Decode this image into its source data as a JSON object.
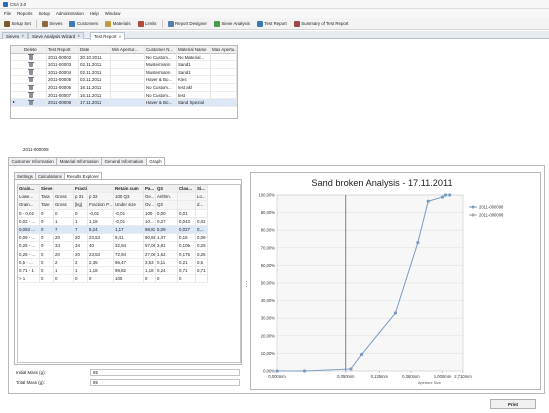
{
  "app": {
    "title": "CSA 3.0"
  },
  "menu": [
    "File",
    "Reports",
    "Setup",
    "Administration",
    "Help",
    "Window"
  ],
  "toolbar": [
    {
      "label": "Setup Set",
      "icon": "setup-icon",
      "color": "#7a5a2a"
    },
    {
      "label": "Sieves",
      "icon": "sieve-icon",
      "color": "#8b6b3a"
    },
    {
      "label": "Customers",
      "icon": "customers-icon",
      "color": "#3e78b9"
    },
    {
      "label": "Materials",
      "icon": "materials-icon",
      "color": "#c29a3f"
    },
    {
      "label": "Limits",
      "icon": "limits-icon",
      "color": "#b24a3b"
    },
    {
      "label": "Report Designer",
      "icon": "report-designer-icon",
      "color": "#5b7ea8"
    },
    {
      "label": "Sieve Analysis",
      "icon": "sieve-analysis-icon",
      "color": "#4a9a4a"
    },
    {
      "label": "Test Report",
      "icon": "test-report-icon",
      "color": "#3a7ab0"
    },
    {
      "label": "Summary of Test Report",
      "icon": "summary-icon",
      "color": "#a04848"
    }
  ],
  "doc_tabs": [
    {
      "label": "Sieves"
    },
    {
      "label": "Sieve Analysis Wizard"
    },
    {
      "label": "Test Report"
    }
  ],
  "reports": {
    "columns": [
      "Delete",
      "Test Report",
      "Date",
      "Min Apertur...",
      "Customer N...",
      "Material Name",
      "Max Apertu..."
    ],
    "rows": [
      [
        "",
        "2011-00002",
        "30.10.2011",
        "",
        "No Custom...",
        "No Material...",
        ""
      ],
      [
        "",
        "2011-00003",
        "02.11.2011",
        "",
        "Mustermann",
        "Sand1",
        ""
      ],
      [
        "",
        "2011-00004",
        "02.11.2011",
        "",
        "Mustermann",
        "Sand1",
        ""
      ],
      [
        "",
        "2011-00005",
        "03.11.2011",
        "",
        "Haver & Bo...",
        "Kies",
        ""
      ],
      [
        "",
        "2011-00006",
        "16.11.2011",
        "",
        "No Custom...",
        "test akl",
        ""
      ],
      [
        "",
        "2011-00007",
        "16.11.2011",
        "",
        "No Custom...",
        "test",
        ""
      ],
      [
        "",
        "2011-00008",
        "17.11.2011",
        "",
        "Haver & Bo...",
        "Sand Spezial",
        ""
      ]
    ],
    "selected_index": 6
  },
  "selected_report_id": "2011-000008",
  "section_tabs": [
    "Customer Information",
    "Material Information",
    "General Information",
    "Graph"
  ],
  "sub_tabs": [
    "Settings",
    "Calculations",
    "Results Explorer"
  ],
  "results": {
    "header": [
      "Grain...",
      "Sieve Weight",
      "",
      "Fraction Retain",
      "",
      "Retain cum",
      "Pa...",
      "Q3",
      "Clas...",
      "Si..."
    ],
    "subheader": [
      "Lowe...",
      "Tara",
      "Gross",
      "p 31",
      "p 32",
      "100 Q3",
      "Ge...",
      "Arithm.",
      "",
      "Lo..."
    ],
    "units": [
      "Grain...",
      "Tare",
      "Gross",
      "[kg]",
      "Fraction P...",
      "Under size",
      "Ov...",
      "Q3",
      "",
      "d..."
    ],
    "rows": [
      [
        "0 - 0,02",
        "0",
        "0",
        "0",
        "-0,01",
        "-0,01",
        "100",
        "0,00",
        "0,01",
        ""
      ],
      [
        "0,02 - ...",
        "0",
        "1",
        "1",
        "1,18",
        "-0,01",
        "10...",
        "0,27",
        "0,043",
        "0,02"
      ],
      [
        "0,063 ...",
        "0",
        "7",
        "7",
        "8,24",
        "1,17",
        "98,83",
        "5,09",
        "0,027",
        "0,..."
      ],
      [
        "0,09 - ...",
        "0",
        "20",
        "20",
        "23,53",
        "9,41",
        "90,59",
        "1,47",
        "0,16",
        "0,09"
      ],
      [
        "0,25 - ...",
        "0",
        "34",
        "34",
        "40",
        "32,94",
        "67,06",
        "3,81",
        "0,105",
        "0,25"
      ],
      [
        "0,25 - ...",
        "0",
        "20",
        "20",
        "23,53",
        "72,94",
        "27,06",
        "1,62",
        "0,175",
        "0,25"
      ],
      [
        "0,5 - ...",
        "0",
        "2",
        "2",
        "2,35",
        "96,47",
        "3,53",
        "0,11",
        "0,21",
        "0,5"
      ],
      [
        "0,71 - 1",
        "0",
        "1",
        "1",
        "1,18",
        "98,82",
        "1,18",
        "0,24",
        "0,71",
        "0,71"
      ],
      [
        "> 1",
        "0",
        "0",
        "0",
        "0",
        "100",
        "0",
        "0",
        "0",
        ""
      ]
    ],
    "selected_index": 2
  },
  "summary": {
    "initial_mass_label": "Initial Mass (g):",
    "initial_mass_value": "85",
    "total_mass_label": "Total Mass (g):",
    "total_mass_value": "85"
  },
  "print_label": "Print",
  "chart_data": {
    "type": "line",
    "title": "Sand broken Analysis - 17.11.2011",
    "xlabel": "Aperture Size",
    "ylabel": "",
    "x_tick_labels": [
      "0,000mm",
      "0,050mm",
      "0,135mm",
      "0,360mm",
      "1,000mm",
      "2,710mm"
    ],
    "y_tick_labels": [
      "0,00%",
      "10,00%",
      "20,00%",
      "30,00%",
      "40,00%",
      "50,00%",
      "60,00%",
      "70,00%",
      "80,00%",
      "90,00%",
      "100,00%"
    ],
    "ylim": [
      0,
      100
    ],
    "series": [
      {
        "name": "2011-000008",
        "color": "#7a9cc4",
        "x": [
          0.0,
          0.02,
          0.063,
          0.09,
          0.25,
          0.5,
          0.71,
          1.0,
          1.25,
          1.6
        ],
        "y": [
          0,
          0,
          1.17,
          9.41,
          32.94,
          72.94,
          96.47,
          98.82,
          100,
          100
        ]
      },
      {
        "name": "2011-000008",
        "color": "#9aa3ad",
        "x": [],
        "y": []
      }
    ],
    "vertical_marker_x": 0.05,
    "grid": true,
    "legend": "right"
  }
}
